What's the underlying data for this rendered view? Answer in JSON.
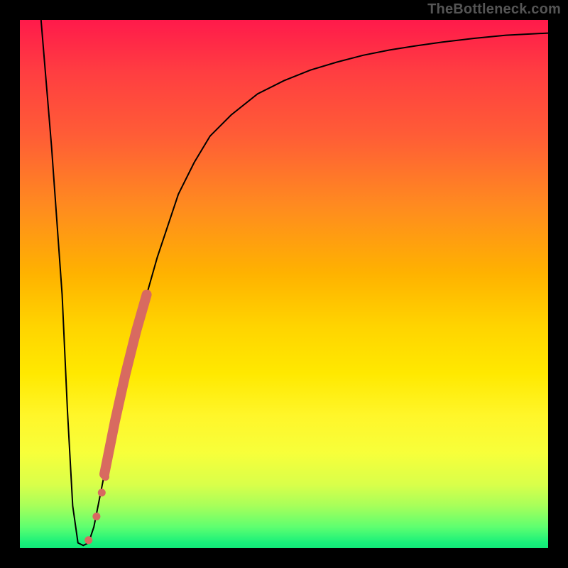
{
  "watermark": "TheBottleneck.com",
  "chart_data": {
    "type": "line",
    "title": "",
    "xlabel": "",
    "ylabel": "",
    "xlim": [
      0,
      100
    ],
    "ylim": [
      0,
      100
    ],
    "grid": false,
    "legend": false,
    "background": "rainbow-vertical-gradient",
    "series": [
      {
        "name": "bottleneck-curve",
        "color": "#000000",
        "x": [
          4,
          6,
          8,
          9,
          10,
          11,
          12,
          13,
          14,
          16,
          18,
          20,
          22,
          24,
          26,
          28,
          30,
          33,
          36,
          40,
          45,
          50,
          55,
          60,
          65,
          70,
          75,
          80,
          86,
          92,
          100
        ],
        "y": [
          100,
          76,
          48,
          26,
          8,
          1,
          0.5,
          1,
          4,
          14,
          24,
          33,
          41,
          48,
          55,
          61,
          67,
          73,
          78,
          82,
          86,
          88.5,
          90.5,
          92,
          93.3,
          94.3,
          95.1,
          95.8,
          96.5,
          97.1,
          97.5
        ]
      }
    ],
    "annotations": {
      "highlight_segment": {
        "description": "thick coral stroke along rising part of curve near the valley",
        "color": "#d86a60",
        "x_range": [
          16,
          24
        ],
        "y_range": [
          14,
          48
        ]
      },
      "marker_dots": [
        {
          "x": 13.0,
          "y": 1.5
        },
        {
          "x": 14.5,
          "y": 6.0
        },
        {
          "x": 15.5,
          "y": 10.5
        },
        {
          "x": 16.2,
          "y": 13.5
        }
      ]
    }
  },
  "colors": {
    "gradient_top": "#ff1a4b",
    "gradient_mid": "#ffe900",
    "gradient_bottom": "#18f07a",
    "curve": "#000000",
    "highlight": "#d86a60",
    "frame": "#000000"
  }
}
